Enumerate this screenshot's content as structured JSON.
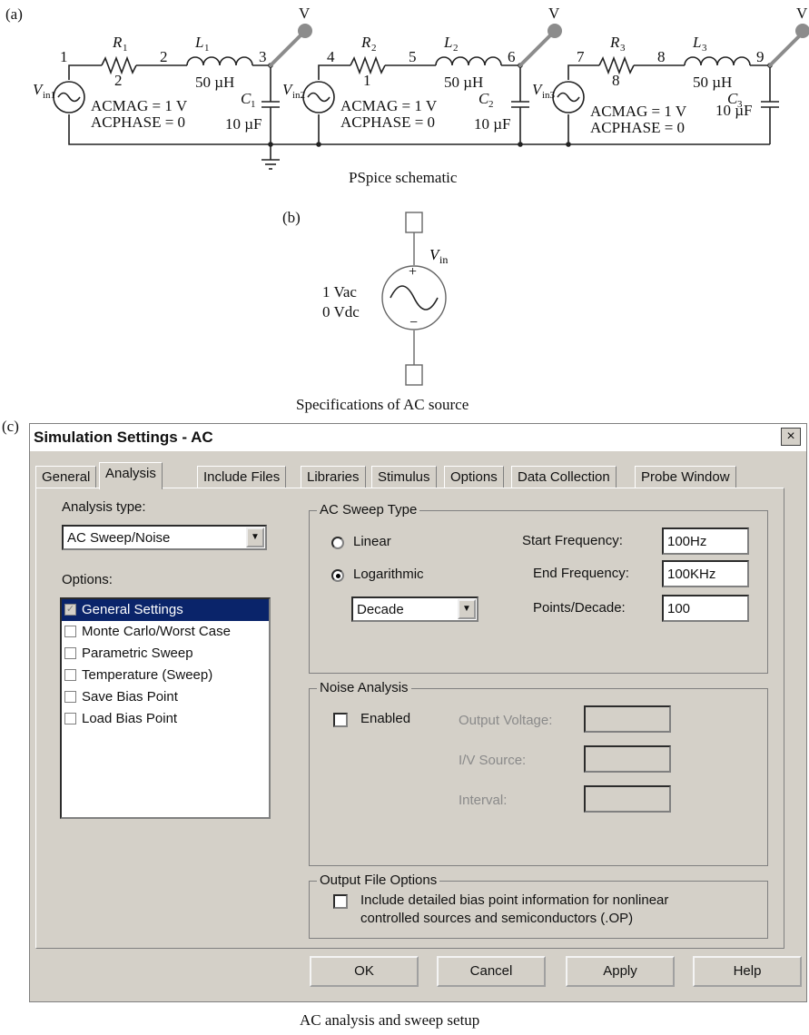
{
  "part_labels": {
    "a": "(a)",
    "b": "(b)",
    "c": "(c)"
  },
  "schematic": {
    "caption": "PSpice schematic",
    "probe_label": "V",
    "stages": [
      {
        "source": "in1",
        "resistor": "1",
        "r_value": "2",
        "inductor": "1",
        "l_value": "50 µH",
        "capacitor": "1",
        "c_value": "10 µF",
        "nodes": [
          "1",
          "2",
          "3"
        ],
        "acmag": "ACMAG = 1 V",
        "acphase": "ACPHASE = 0"
      },
      {
        "source": "in2",
        "resistor": "2",
        "r_value": "1",
        "inductor": "2",
        "l_value": "50 µH",
        "capacitor": "2",
        "c_value": "10 µF",
        "nodes": [
          "4",
          "5",
          "6"
        ],
        "acmag": "ACMAG = 1 V",
        "acphase": "ACPHASE = 0"
      },
      {
        "source": "in3",
        "resistor": "3",
        "r_value": "8",
        "inductor": "3",
        "l_value": "50 µH",
        "capacitor": "3",
        "c_value": "10 µF",
        "nodes": [
          "7",
          "8",
          "9"
        ],
        "acmag": "ACMAG = 1 V",
        "acphase": "ACPHASE = 0"
      }
    ]
  },
  "source_spec": {
    "name_sub": "in",
    "ac_value": "1 Vac",
    "dc_value": "0 Vdc",
    "plus": "+",
    "minus": "−",
    "caption": "Specifications of AC source"
  },
  "dialog": {
    "title": "Simulation Settings - AC",
    "close_glyph": "×",
    "tabs": [
      "General",
      "Analysis",
      "Include Files",
      "Libraries",
      "Stimulus",
      "Options",
      "Data Collection",
      "Probe Window"
    ],
    "active_tab": "Analysis",
    "analysis_type_label": "Analysis type:",
    "analysis_type_value": "AC Sweep/Noise",
    "options_label": "Options:",
    "options": [
      "General Settings",
      "Monte Carlo/Worst Case",
      "Parametric Sweep",
      "Temperature (Sweep)",
      "Save Bias Point",
      "Load Bias Point"
    ],
    "sweep_group": "AC Sweep Type",
    "linear_label": "Linear",
    "log_label": "Logarithmic",
    "log_scale_value": "Decade",
    "start_label": "Start Frequency:",
    "start_value": "100Hz",
    "end_label": "End Frequency:",
    "end_value": "100KHz",
    "points_label": "Points/Decade:",
    "points_value": "100",
    "noise_group": "Noise Analysis",
    "enabled_label": "Enabled",
    "output_voltage_label": "Output Voltage:",
    "iv_source_label": "I/V Source:",
    "interval_label": "Interval:",
    "output_group": "Output File Options",
    "bias_line1": "Include detailed bias point information for nonlinear",
    "bias_line2": "controlled sources and semiconductors (.OP)",
    "buttons": {
      "ok": "OK",
      "cancel": "Cancel",
      "apply": "Apply",
      "help": "Help"
    }
  },
  "setup_caption": "AC analysis and sweep setup",
  "colors": {
    "probe": "#8c8c8c",
    "selection": "#0a246a",
    "dialog_bg": "#d4d0c8"
  }
}
